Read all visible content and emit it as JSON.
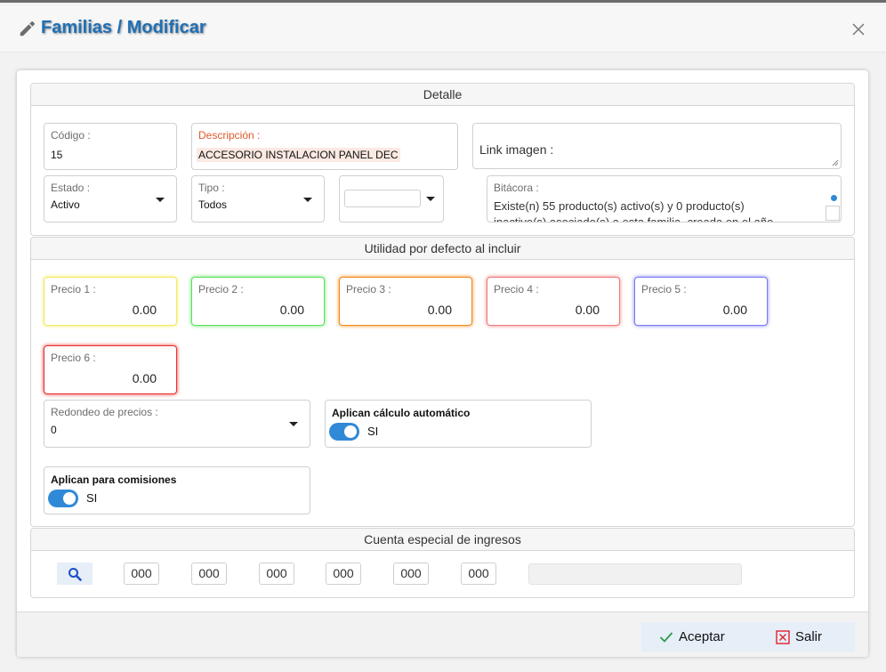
{
  "dialog": {
    "title": "Familias / Modificar"
  },
  "detalle": {
    "heading": "Detalle",
    "codigo_label": "Código :",
    "codigo_value": "15",
    "descripcion_label": "Descripción :",
    "descripcion_value": "ACCESORIO INSTALACION PANEL DEC",
    "link_imagen_label": "Link imagen :",
    "estado_label": "Estado :",
    "estado_value": "Activo",
    "tipo_label": "Tipo :",
    "tipo_value": "Todos",
    "bitacora_label": "Bitácora :",
    "bitacora_line1": "Existe(n) 55 producto(s) activo(s) y 0 producto(s)",
    "bitacora_line2": "inactivo(s) asociado(s) a esta familia, creada en el año"
  },
  "utilidad": {
    "heading": "Utilidad por defecto al incluir",
    "prices": [
      {
        "label": "Precio 1 :",
        "value": "0.00",
        "color": "#f2e860"
      },
      {
        "label": "Precio 2 :",
        "value": "0.00",
        "color": "#5ee05e"
      },
      {
        "label": "Precio 3 :",
        "value": "0.00",
        "color": "#f08a1c"
      },
      {
        "label": "Precio 4 :",
        "value": "0.00",
        "color": "#f07a7a"
      },
      {
        "label": "Precio 5 :",
        "value": "0.00",
        "color": "#7a7af0"
      },
      {
        "label": "Precio 6 :",
        "value": "0.00",
        "color": "#e83030"
      }
    ],
    "redondeo_label": "Redondeo de precios :",
    "redondeo_value": "0",
    "calculo_label": "Aplican cálculo automático",
    "calculo_state": "SI",
    "comisiones_label": "Aplican para comisiones",
    "comisiones_state": "SI"
  },
  "cuenta": {
    "heading": "Cuenta especial de ingresos",
    "segments": [
      "000",
      "000",
      "000",
      "000",
      "000",
      "000"
    ]
  },
  "footer": {
    "accept_label": "Aceptar",
    "exit_label": "Salir"
  },
  "colors": {
    "accent": "#2f89d6",
    "title": "#1f6fb5",
    "descripcion_label": "#e0582c",
    "exit_icon": "#e0202a",
    "accept_icon": "#2e9a4a"
  },
  "icons": [
    "pencil-icon",
    "close-icon",
    "search-icon",
    "check-icon",
    "close-box-icon",
    "chevron-down-icon",
    "resize-handle-icon"
  ]
}
